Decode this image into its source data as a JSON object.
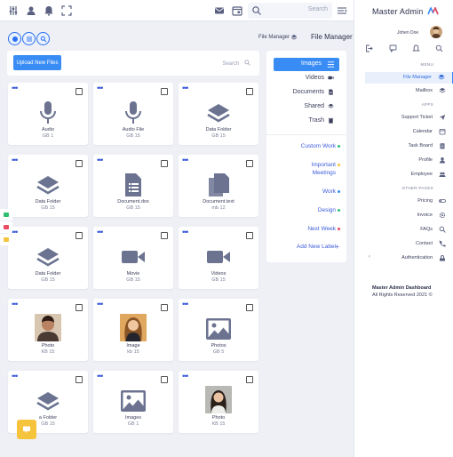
{
  "topbar": {
    "search_placeholder": "Search"
  },
  "breadcrumb": {
    "parent": "File Manager",
    "title": "File Manager"
  },
  "upload": {
    "button_label": "Upload New Files",
    "search_placeholder": "Search"
  },
  "files": [
    {
      "name": "Audio",
      "size": "GB 1",
      "icon": "microphone-icon"
    },
    {
      "name": "Audio File",
      "size": "GB 15",
      "icon": "microphone-icon"
    },
    {
      "name": "Data Folder",
      "size": "GB 15",
      "icon": "layers-icon"
    },
    {
      "name": "Data Folder",
      "size": "GB 15",
      "icon": "layers-icon"
    },
    {
      "name": "Document.dox",
      "size": "GB 15",
      "icon": "document-icon"
    },
    {
      "name": "Document.text",
      "size": "mb 12",
      "icon": "copy-document-icon"
    },
    {
      "name": "Data Folder",
      "size": "GB 15",
      "icon": "layers-icon"
    },
    {
      "name": "Movie",
      "size": "GB 15",
      "icon": "video-camera-icon"
    },
    {
      "name": "Videos",
      "size": "GB 15",
      "icon": "video-camera-icon"
    },
    {
      "name": "Photo",
      "size": "KB 15",
      "icon": "photo-thumbnail"
    },
    {
      "name": "Image",
      "size": "kb 15",
      "icon": "photo-thumbnail"
    },
    {
      "name": "Photos",
      "size": "GB 5",
      "icon": "image-icon"
    },
    {
      "name": "a Folder",
      "size": "GB 15",
      "icon": "layers-icon"
    },
    {
      "name": "Images",
      "size": "GB 1",
      "icon": "image-icon"
    },
    {
      "name": "Photo",
      "size": "KB 15",
      "icon": "photo-thumbnail"
    }
  ],
  "categories": {
    "active": "Images",
    "items": [
      "Videos",
      "Documents",
      "Shared",
      "Trash"
    ]
  },
  "labels": [
    {
      "text": "Custom Work",
      "color": "#2fbf71"
    },
    {
      "text": "Important Meetings",
      "color": "#f6c33c"
    },
    {
      "text": "Work",
      "color": "#3a8cf5"
    },
    {
      "text": "Design",
      "color": "#2fbf71"
    },
    {
      "text": "Next Week",
      "color": "#e84a5f"
    }
  ],
  "add_label": "Add New Label",
  "sidebar": {
    "brand": "Master Admin",
    "user_name": "Johen Doe",
    "section_menu": "MENU",
    "menu": [
      "File Manager",
      "Mailbox"
    ],
    "section_apps": "APPS",
    "apps": [
      "Support Ticket",
      "Calendar",
      "Task Board",
      "Profile",
      "Employee"
    ],
    "section_other": "OTHER PAGES",
    "other": [
      "Pricing",
      "Invoice",
      "FAQs",
      "Contact",
      "Authentication"
    ],
    "footer_title": "Master Admin Dashboard",
    "footer_text": "All Rights Reserved 2021 ©"
  },
  "colors": {
    "accent": "#3a8cf5",
    "icon_gray": "#6b7390",
    "fab": "#f6c33c"
  }
}
